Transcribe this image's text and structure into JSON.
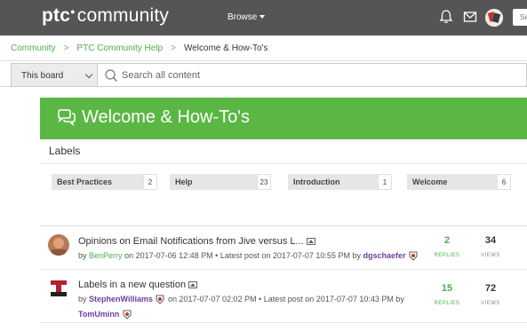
{
  "header": {
    "logo_ptc": "ptc",
    "logo_community": "community",
    "browse_label": "Browse",
    "search_placeholder": "Se"
  },
  "breadcrumb": {
    "items": [
      "Community",
      "PTC Community Help",
      "Welcome & How-To's"
    ],
    "separator": ">"
  },
  "search": {
    "scope": "This board",
    "placeholder": "Search all content"
  },
  "hero": {
    "title": "Welcome & How-To's"
  },
  "labels": {
    "heading": "Labels",
    "items": [
      {
        "name": "Best Practices",
        "count": "2"
      },
      {
        "name": "Help",
        "count": "23"
      },
      {
        "name": "Introduction",
        "count": "1"
      },
      {
        "name": "Welcome",
        "count": "6"
      }
    ]
  },
  "messages": [
    {
      "subject": "Opinions on Email Notifications from Jive versus L...",
      "by": "by",
      "author": "BenPerry",
      "posted_prefix": "on 2017-07-06 12:48 PM",
      "dot": "•",
      "latest": "Latest post on 2017-07-07 10:55 PM by",
      "latest_author": "dgschaefer",
      "replies": "2",
      "replies_label": "REPLIES",
      "views": "34",
      "views_label": "VIEWS"
    },
    {
      "subject": "Labels in a new question",
      "by": "by",
      "author": "StephenWilliams",
      "posted_prefix": "on 2017-07-07 02:02 PM",
      "dot": "•",
      "latest": "Latest post on 2017-07-07 10:43 PM by",
      "latest_author": "TomUminn",
      "replies": "15",
      "replies_label": "REPLIES",
      "views": "72",
      "views_label": "VIEWS"
    }
  ],
  "colors": {
    "topbar": "#555555",
    "accent_green": "#5bb744",
    "link_green": "#4cae48",
    "username_purple": "#6b3fa0"
  }
}
